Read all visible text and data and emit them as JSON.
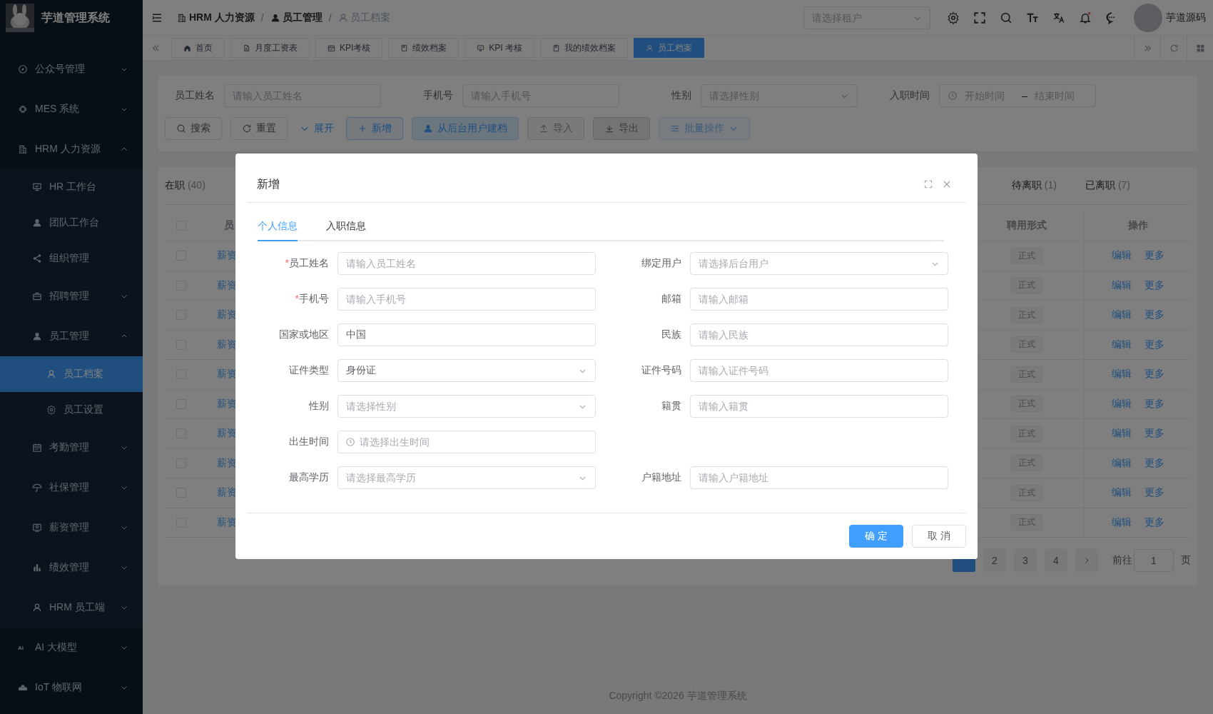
{
  "sidebar": {
    "logo_text": "芋道管理系统",
    "items": [
      {
        "label": "公众号管理",
        "kind": "group",
        "expanded": false
      },
      {
        "label": "MES 系统",
        "kind": "group",
        "expanded": false
      },
      {
        "label": "HRM 人力资源",
        "kind": "group",
        "expanded": true,
        "children": [
          {
            "label": "HR 工作台",
            "kind": "link",
            "selected": false
          },
          {
            "label": "团队工作台",
            "kind": "link",
            "selected": false
          },
          {
            "label": "组织管理",
            "kind": "link",
            "selected": false
          },
          {
            "label": "招聘管理",
            "kind": "group",
            "expanded": false
          },
          {
            "label": "员工管理",
            "kind": "group",
            "expanded": true,
            "children": [
              {
                "label": "员工档案",
                "kind": "link",
                "selected": true
              },
              {
                "label": "员工设置",
                "kind": "link",
                "selected": false
              }
            ]
          },
          {
            "label": "考勤管理",
            "kind": "group",
            "expanded": false
          },
          {
            "label": "社保管理",
            "kind": "group",
            "expanded": false
          },
          {
            "label": "薪资管理",
            "kind": "group",
            "expanded": false
          },
          {
            "label": "绩效管理",
            "kind": "group",
            "expanded": false
          },
          {
            "label": "HRM 员工端",
            "kind": "group",
            "expanded": false
          }
        ]
      },
      {
        "label": "AI 大模型",
        "kind": "group",
        "expanded": false,
        "icon_text": "AI"
      },
      {
        "label": "IoT 物联网",
        "kind": "group",
        "expanded": false
      }
    ]
  },
  "header": {
    "breadcrumb": [
      {
        "label": "HRM 人力资源",
        "current": false
      },
      {
        "label": "员工管理",
        "current": false
      },
      {
        "label": "员工档案",
        "current": true
      }
    ],
    "separator": "/",
    "tenant_placeholder": "请选择租户",
    "notification_dot": true,
    "user_name": "芋道源码"
  },
  "page_tabs": [
    {
      "label": "首页",
      "selected": false
    },
    {
      "label": "月度工资表",
      "selected": false
    },
    {
      "label": "KPI考核",
      "selected": false
    },
    {
      "label": "绩效档案",
      "selected": false
    },
    {
      "label": "KPI 考核",
      "selected": false
    },
    {
      "label": "我的绩效档案",
      "selected": false
    },
    {
      "label": "员工档案",
      "selected": true
    }
  ],
  "filters": [
    {
      "label": "员工姓名",
      "kind": "input",
      "placeholder": "请输入员工姓名"
    },
    {
      "label": "手机号",
      "kind": "input",
      "placeholder": "请输入手机号"
    },
    {
      "label": "性别",
      "kind": "select",
      "placeholder": "请选择性别"
    },
    {
      "label": "入职时间",
      "kind": "date_range",
      "start_placeholder": "开始时间",
      "separator": "–",
      "end_placeholder": "结束时间"
    }
  ],
  "actions": [
    {
      "label": "搜索",
      "kind": "default",
      "disabled": false
    },
    {
      "label": "重置",
      "kind": "default",
      "disabled": false
    },
    {
      "label": "展开",
      "kind": "text",
      "disabled": false
    },
    {
      "label": "新增",
      "kind": "primary_plain",
      "disabled": false
    },
    {
      "label": "从后台用户建档",
      "kind": "primary_light",
      "disabled": false
    },
    {
      "label": "导入",
      "kind": "neutral",
      "disabled": false
    },
    {
      "label": "导出",
      "kind": "neutral_dark",
      "disabled": false
    },
    {
      "label": "批量操作",
      "kind": "dropdown",
      "disabled": true
    }
  ],
  "table": {
    "status_tabs": [
      {
        "label": "在职",
        "count": "(40)"
      },
      {
        "label": "待离职",
        "count": "(1)"
      },
      {
        "label": "已离职",
        "count": "(7)"
      }
    ],
    "columns": [
      "员",
      "聘用形式",
      "操作"
    ],
    "header_checked": false,
    "rows": [
      {
        "checked": false,
        "column_1": "薪资",
        "employment": "正式",
        "actions": [
          "编辑",
          "更多"
        ]
      },
      {
        "checked": false,
        "column_1": "薪资",
        "employment": "正式",
        "actions": [
          "编辑",
          "更多"
        ]
      },
      {
        "checked": false,
        "column_1": "薪资",
        "employment": "正式",
        "actions": [
          "编辑",
          "更多"
        ]
      },
      {
        "checked": false,
        "column_1": "薪资",
        "employment": "正式",
        "actions": [
          "编辑",
          "更多"
        ]
      },
      {
        "checked": false,
        "column_1": "薪资",
        "employment": "正式",
        "actions": [
          "编辑",
          "更多"
        ]
      },
      {
        "checked": false,
        "column_1": "薪资",
        "employment": "正式",
        "actions": [
          "编辑",
          "更多"
        ]
      },
      {
        "checked": false,
        "column_1": "薪资",
        "employment": "正式",
        "actions": [
          "编辑",
          "更多"
        ]
      },
      {
        "checked": false,
        "column_1": "薪资",
        "employment": "正式",
        "actions": [
          "编辑",
          "更多"
        ]
      },
      {
        "checked": false,
        "column_1": "薪资",
        "employment": "正式",
        "actions": [
          "编辑",
          "更多"
        ]
      },
      {
        "checked": false,
        "column_1": "薪资",
        "employment": "正式",
        "actions": [
          "编辑",
          "更多"
        ]
      }
    ]
  },
  "pagination": {
    "pages": [
      "2",
      "3",
      "4"
    ],
    "jump_label": "前往",
    "jump_value": "1",
    "page_suffix": "页"
  },
  "copyright": "Copyright ©2026 芋道管理系统",
  "dialog": {
    "title": "新增",
    "required_mark": "*",
    "tabs": [
      {
        "label": "个人信息",
        "selected": true
      },
      {
        "label": "入职信息",
        "selected": false
      }
    ],
    "rows": [
      [
        {
          "label": "员工姓名",
          "required": true,
          "kind": "input",
          "placeholder": "请输入员工姓名"
        },
        {
          "label": "绑定用户",
          "required": false,
          "kind": "select",
          "placeholder": "请选择后台用户"
        }
      ],
      [
        {
          "label": "手机号",
          "required": true,
          "kind": "input",
          "placeholder": "请输入手机号"
        },
        {
          "label": "邮箱",
          "required": false,
          "kind": "input",
          "placeholder": "请输入邮箱"
        }
      ],
      [
        {
          "label": "国家或地区",
          "required": false,
          "kind": "input",
          "value": "中国"
        },
        {
          "label": "民族",
          "required": false,
          "kind": "input",
          "placeholder": "请输入民族"
        }
      ],
      [
        {
          "label": "证件类型",
          "required": false,
          "kind": "select",
          "value": "身份证"
        },
        {
          "label": "证件号码",
          "required": false,
          "kind": "input",
          "placeholder": "请输入证件号码"
        }
      ],
      [
        {
          "label": "性别",
          "required": false,
          "kind": "select",
          "placeholder": "请选择性别"
        },
        {
          "label": "籍贯",
          "required": false,
          "kind": "input",
          "placeholder": "请输入籍贯"
        }
      ],
      [
        {
          "label": "出生时间",
          "required": false,
          "kind": "date",
          "placeholder": "请选择出生时间"
        }
      ],
      [
        {
          "label": "最高学历",
          "required": false,
          "kind": "select",
          "placeholder": "请选择最高学历"
        },
        {
          "label": "户籍地址",
          "required": false,
          "kind": "input",
          "placeholder": "请输入户籍地址"
        }
      ]
    ],
    "buttons": [
      {
        "label": "确 定",
        "kind": "primary"
      },
      {
        "label": "取 消",
        "kind": "default"
      }
    ]
  }
}
